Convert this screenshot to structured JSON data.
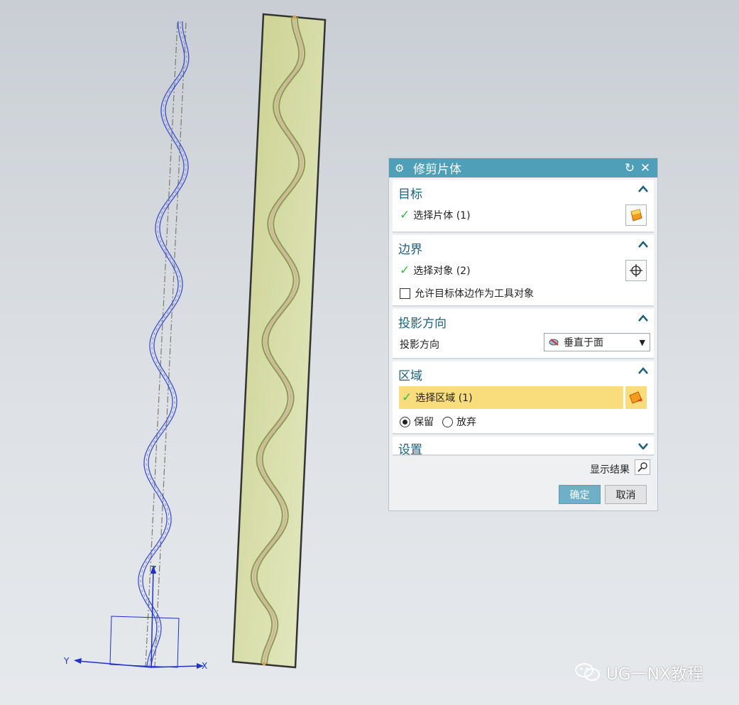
{
  "dialog": {
    "title": "修剪片体",
    "target": {
      "header": "目标",
      "select_label": "选择片体 (1)"
    },
    "boundary": {
      "header": "边界",
      "select_label": "选择对象 (2)",
      "allow_label": "允许目标体边作为工具对象"
    },
    "projection": {
      "header": "投影方向",
      "label": "投影方向",
      "selected": "垂直于面"
    },
    "region": {
      "header": "区域",
      "select_label": "选择区域 (1)",
      "keep_label": "保留",
      "discard_label": "放弃"
    },
    "settings": {
      "header": "设置"
    },
    "show_result_label": "显示结果",
    "ok_label": "确定",
    "cancel_label": "取消"
  },
  "viewport": {
    "axis_z": "Z",
    "axis_y": "Y",
    "axis_x": "X"
  },
  "watermark": {
    "text": "UG一NX教程"
  },
  "colors": {
    "title_bar": "#4f9fb8",
    "header_text": "#1e5f7a",
    "highlight": "#f9dc7c",
    "curve": "#3a4fd6",
    "sheet": "#d9dfa8"
  }
}
